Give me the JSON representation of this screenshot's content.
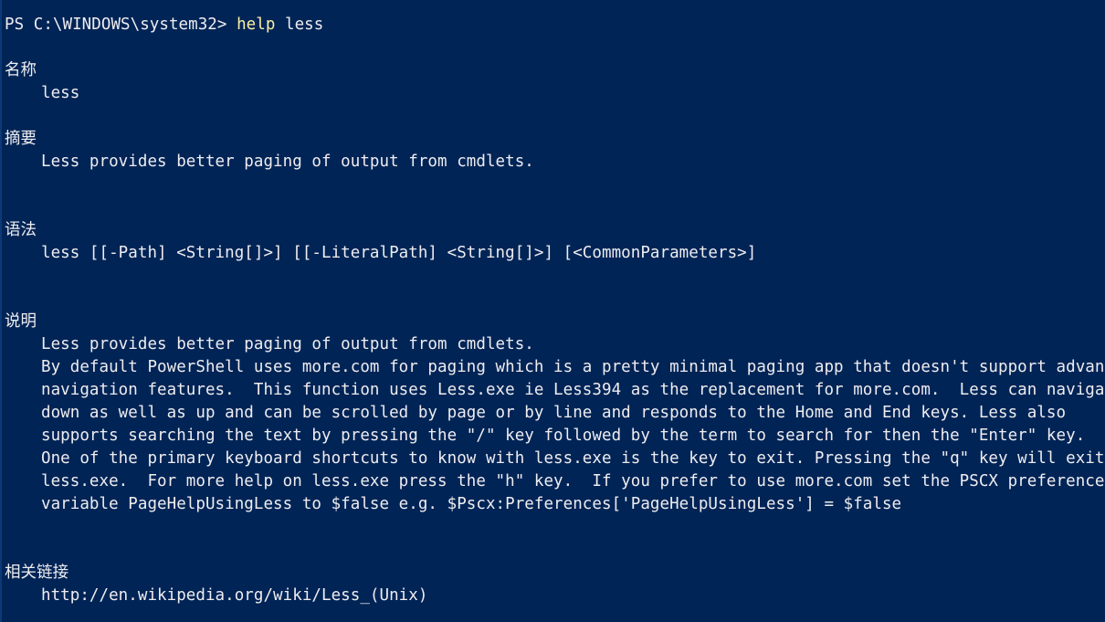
{
  "window": {
    "background_color": "#012456",
    "text_color": "#eeedf0",
    "command_color": "#f9f1a5"
  },
  "prompt": {
    "path": "PS C:\\WINDOWS\\system32> ",
    "command": "help",
    "argument": " less"
  },
  "sections": {
    "name": {
      "heading": "名称",
      "lines": [
        "less"
      ]
    },
    "synopsis": {
      "heading": "摘要",
      "lines": [
        "Less provides better paging of output from cmdlets."
      ]
    },
    "syntax": {
      "heading": "语法",
      "lines": [
        "less [[-Path] <String[]>] [[-LiteralPath] <String[]>] [<CommonParameters>]"
      ]
    },
    "description": {
      "heading": "说明",
      "lines": [
        "Less provides better paging of output from cmdlets.",
        "By default PowerShell uses more.com for paging which is a pretty minimal paging app that doesn't support advanced",
        "navigation features.  This function uses Less.exe ie Less394 as the replacement for more.com.  Less can navigate",
        "down as well as up and can be scrolled by page or by line and responds to the Home and End keys. Less also",
        "supports searching the text by pressing the \"/\" key followed by the term to search for then the \"Enter\" key.",
        "One of the primary keyboard shortcuts to know with less.exe is the key to exit. Pressing the \"q\" key will exit",
        "less.exe.  For more help on less.exe press the \"h\" key.  If you prefer to use more.com set the PSCX preference",
        "variable PageHelpUsingLess to $false e.g. $Pscx:Preferences['PageHelpUsingLess'] = $false"
      ]
    },
    "related_links": {
      "heading": "相关链接",
      "lines": [
        "http://en.wikipedia.org/wiki/Less_(Unix)"
      ]
    }
  }
}
